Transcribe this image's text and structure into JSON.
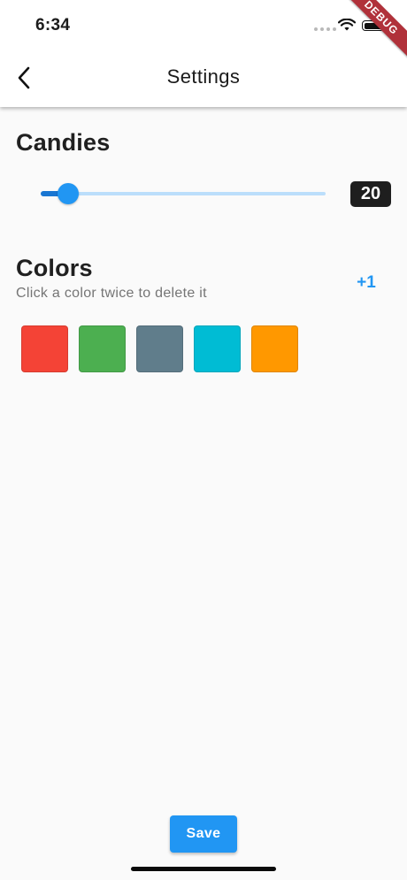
{
  "status_bar": {
    "time": "6:34",
    "icons": [
      "cellular-signal-icon",
      "wifi-icon",
      "battery-icon"
    ]
  },
  "debug_banner": "DEBUG",
  "app_bar": {
    "back_icon": "chevron-left-icon",
    "title": "Settings"
  },
  "candies": {
    "title": "Candies",
    "slider_fraction": 0.095,
    "value": "20"
  },
  "colors": {
    "title": "Colors",
    "subtitle": "Click a color twice to delete it",
    "add_label": "+1",
    "swatches": [
      "#F44336",
      "#4CAF50",
      "#607D8B",
      "#00BCD4",
      "#FF9800"
    ]
  },
  "save_label": "Save",
  "theme": {
    "accent": "#2196F3",
    "slider_active": "#1976D2",
    "slider_inactive": "#BBDEFB",
    "background": "#FAFAFA"
  }
}
